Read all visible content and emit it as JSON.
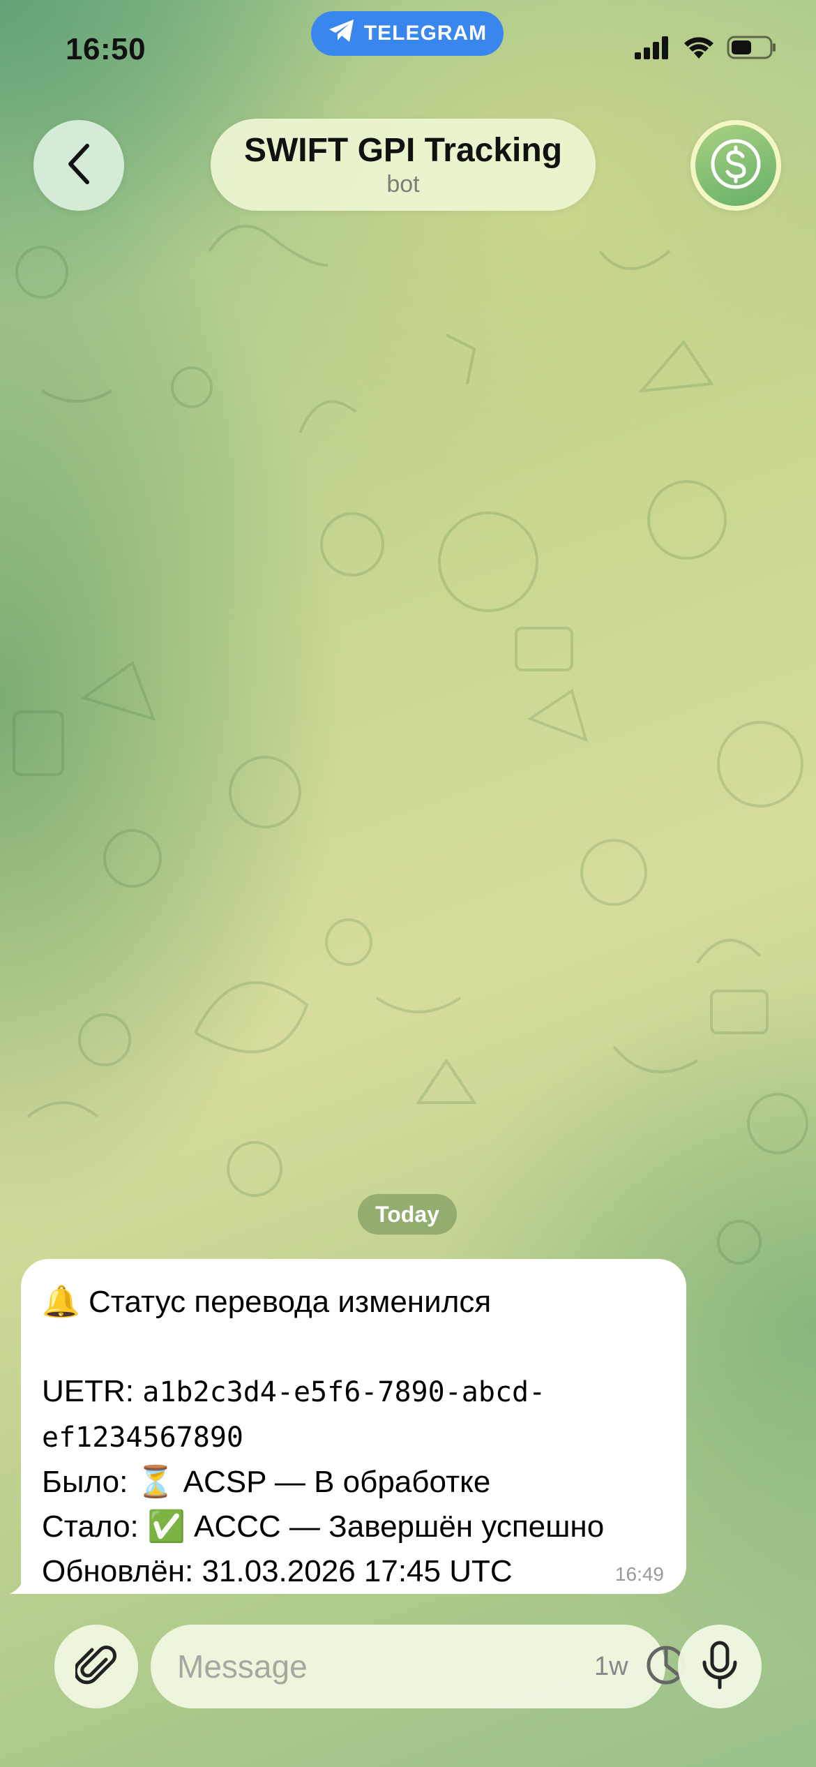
{
  "status_bar": {
    "time": "16:50",
    "app_pill": "TELEGRAM"
  },
  "header": {
    "title": "SWIFT GPI Tracking",
    "subtitle": "bot"
  },
  "chat": {
    "date_separator": "Today",
    "messages": [
      {
        "emoji": "🔔",
        "heading": "Статус перевода изменился",
        "uetr_label": "UETR: ",
        "uetr_part1": "a1b2c3d4-e5f6-7890-abcd-",
        "uetr_part2": "ef1234567890",
        "was_label": "Было: ",
        "was_emoji": "⏳",
        "was_value": " ACSP — В обработке",
        "now_label": "Стало: ",
        "now_emoji": "✅",
        "now_value": " ACCC — Завершён успешно",
        "updated": "Обновлён: 31.03.2026 17:45 UTC",
        "time": "16:49"
      }
    ]
  },
  "composer": {
    "placeholder": "Message",
    "timer_label": "1w"
  },
  "colors": {
    "telegram_blue": "#3a86ef",
    "bubble_bg": "#ffffff",
    "check_green": "#3fba4a"
  },
  "icons": [
    "telegram-plane-icon",
    "signal-icon",
    "wifi-icon",
    "battery-icon",
    "back-chevron-icon",
    "dollar-icon",
    "paperclip-icon",
    "sticker-icon",
    "microphone-icon"
  ]
}
